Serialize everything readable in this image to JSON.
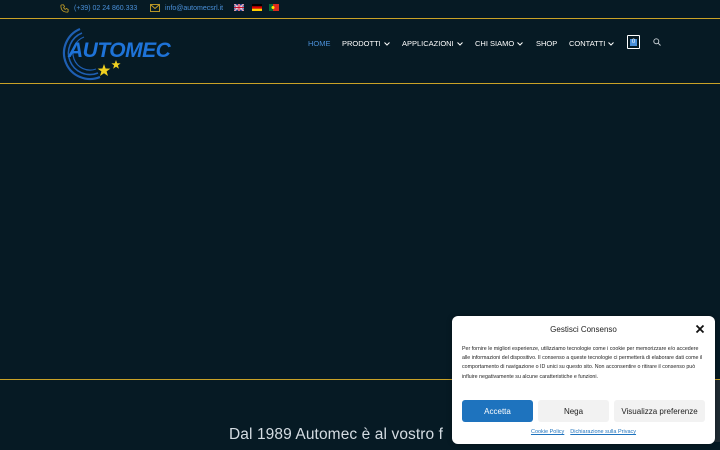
{
  "topbar": {
    "phone": "(+39) 02 24 860.333",
    "email": "info@automecsrl.it",
    "languages": [
      "English",
      "Deutsch",
      "Português"
    ]
  },
  "logo": {
    "text": "AUTOMEC"
  },
  "nav": {
    "items": [
      {
        "label": "HOME",
        "dropdown": false,
        "active": true
      },
      {
        "label": "PRODOTTI",
        "dropdown": true,
        "active": false
      },
      {
        "label": "APPLICAZIONI",
        "dropdown": true,
        "active": false
      },
      {
        "label": "CHI SIAMO",
        "dropdown": true,
        "active": false
      },
      {
        "label": "SHOP",
        "dropdown": false,
        "active": false
      },
      {
        "label": "CONTATTI",
        "dropdown": true,
        "active": false
      }
    ],
    "cart_count": "0"
  },
  "hero": {
    "tagline": "Dal 1989 Automec è al vostro f"
  },
  "consent": {
    "title": "Gestisci Consenso",
    "body": "Per fornire le migliori esperienze, utilizziamo tecnologie come i cookie per memorizzare e/o accedere alle informazioni del dispositivo. Il consenso a queste tecnologie ci permetterà di elaborare dati come il comportamento di navigazione o ID unici su questo sito. Non acconsentire o ritirare il consenso può influire negativamente su alcune caratteristiche e funzioni.",
    "accept": "Accetta",
    "deny": "Nega",
    "preferences": "Visualizza preferenze",
    "cookie_policy": "Cookie Policy",
    "privacy": "Dichiarazione sulla Privacy"
  },
  "colors": {
    "background": "#061a24",
    "accent": "#4a90d9",
    "gold_border": "#c9a227",
    "primary_button": "#1e73be"
  }
}
